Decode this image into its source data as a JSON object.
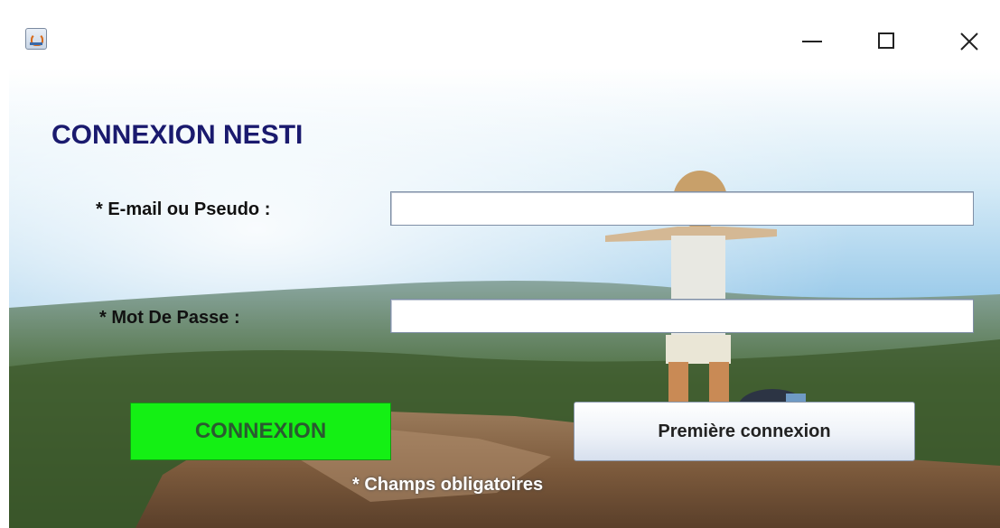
{
  "window": {
    "title": "",
    "controls": {
      "minimize": "minimize",
      "maximize": "maximize",
      "close": "close"
    }
  },
  "form": {
    "heading": "CONNEXION NESTI",
    "email_label": "* E-mail ou Pseudo :",
    "email_value": "",
    "password_label": "* Mot De Passe :",
    "password_value": "",
    "login_button": "CONNEXION",
    "first_login_button": "Première connexion",
    "required_note": "* Champs obligatoires"
  },
  "colors": {
    "heading": "#1a1a6e",
    "login_button": "#14f014",
    "sky": "#8fc3e6"
  },
  "icons": [
    "java-app-icon",
    "minimize-icon",
    "maximize-icon",
    "close-icon"
  ]
}
